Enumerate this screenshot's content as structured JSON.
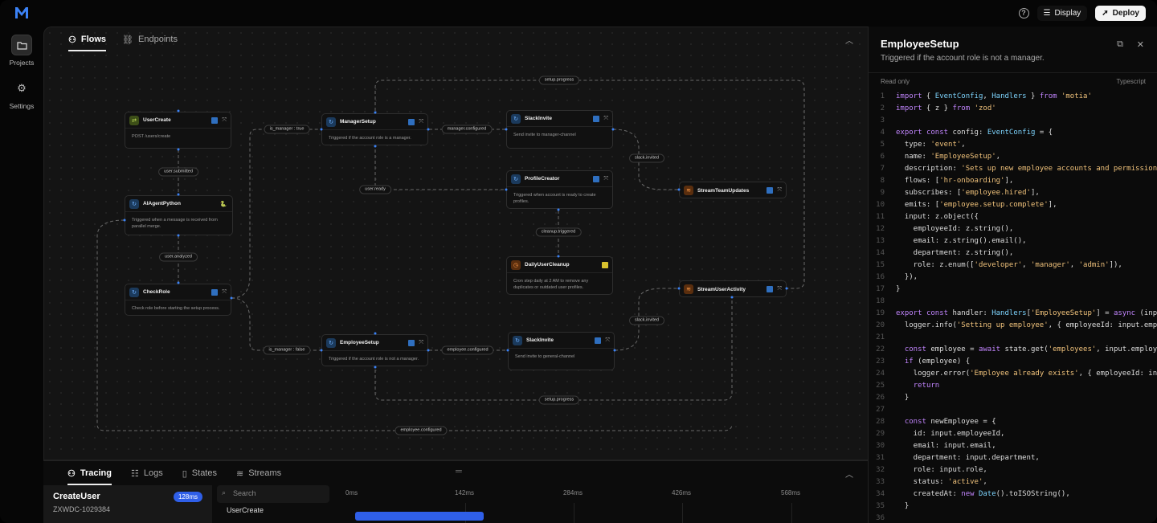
{
  "sidebar": {
    "items": [
      {
        "label": "Projects",
        "icon": "folder-icon"
      },
      {
        "label": "Settings",
        "icon": "gear-icon"
      }
    ]
  },
  "topbar": {
    "display_label": "Display",
    "deploy_label": "Deploy"
  },
  "canvas": {
    "tabs": [
      {
        "label": "Flows"
      },
      {
        "label": "Endpoints"
      }
    ]
  },
  "nodes": {
    "usercreate": {
      "title": "UserCreate",
      "body": "POST  /users/create"
    },
    "aiagent": {
      "title": "AIAgentPython",
      "body": "Triggered when a message is received from parallel merge."
    },
    "checkrole": {
      "title": "CheckRole",
      "body": "Check role before starting the setup process."
    },
    "managersetup": {
      "title": "ManagerSetup",
      "body": "Triggered if the account role is a manager."
    },
    "employeesetup": {
      "title": "EmployeeSetup",
      "body": "Triggered if the account role is not a manager."
    },
    "slack1": {
      "title": "SlackInvite",
      "body": "Send invite to manager-channel"
    },
    "profile": {
      "title": "ProfileCreator",
      "body": "Triggered when account is ready to create profiles."
    },
    "cleanup": {
      "title": "DailyUserCleanup",
      "body": "Cron step daily at 2 AM to remove any duplicates or outdated user profiles."
    },
    "slack2": {
      "title": "SlackInvite",
      "body": "Send invite to general-channel"
    },
    "streamteam": {
      "title": "StreamTeamUpdates"
    },
    "streamuser": {
      "title": "StreamUserActivity"
    }
  },
  "pills": {
    "user_submitted": "user.submitted",
    "user_analyzed": "user.analyzed",
    "is_manager_true": "is_manager :  true",
    "is_manager_false": "is_manager :  false",
    "manager_configured": "manager.configured",
    "employee_configured": "employee.configured",
    "slack_invited_1": "slack.invited",
    "slack_invited_2": "slack.invited",
    "user_ready": "user.ready",
    "cleanup_triggered": "cleanup.triggered",
    "setup_progress_top": "setup.progress",
    "setup_progress_bottom": "setup.progress",
    "employee_configured_bottom": "employee.configured"
  },
  "bottom": {
    "tabs": [
      {
        "label": "Tracing"
      },
      {
        "label": "Logs"
      },
      {
        "label": "States"
      },
      {
        "label": "Streams"
      }
    ],
    "trace": {
      "title": "CreateUser",
      "id": "ZXWDC-1029384",
      "duration": "128ms"
    },
    "search_placeholder": "Search",
    "row_label": "UserCreate",
    "ticks": [
      "0ms",
      "142ms",
      "284ms",
      "426ms",
      "568ms"
    ]
  },
  "panel": {
    "title": "EmployeeSetup",
    "subtitle": "Triggered if the account role is not a manager.",
    "read_only": "Read only",
    "language": "Typescript"
  },
  "code_lines": [
    "import { EventConfig, Handlers } from 'motia'",
    "import { z } from 'zod'",
    "",
    "export const config: EventConfig = {",
    "  type: 'event',",
    "  name: 'EmployeeSetup',",
    "  description: 'Sets up new employee accounts and permissions',",
    "  flows: ['hr-onboarding'],",
    "  subscribes: ['employee.hired'],",
    "  emits: ['employee.setup.complete'],",
    "  input: z.object({",
    "    employeeId: z.string(),",
    "    email: z.string().email(),",
    "    department: z.string(),",
    "    role: z.enum(['developer', 'manager', 'admin']),",
    "  }),",
    "}",
    "",
    "export const handler: Handlers['EmployeeSetup'] = async (input, {",
    "  logger.info('Setting up employee', { employeeId: input.employeeI",
    "",
    "  const employee = await state.get('employees', input.employeeId)",
    "  if (employee) {",
    "    logger.error('Employee already exists', { employeeId: input.em",
    "    return",
    "  }",
    "",
    "  const newEmployee = {",
    "    id: input.employeeId,",
    "    email: input.email,",
    "    department: input.department,",
    "    role: input.role,",
    "    status: 'active',",
    "    createdAt: new Date().toISOString(),",
    "  }",
    ""
  ]
}
